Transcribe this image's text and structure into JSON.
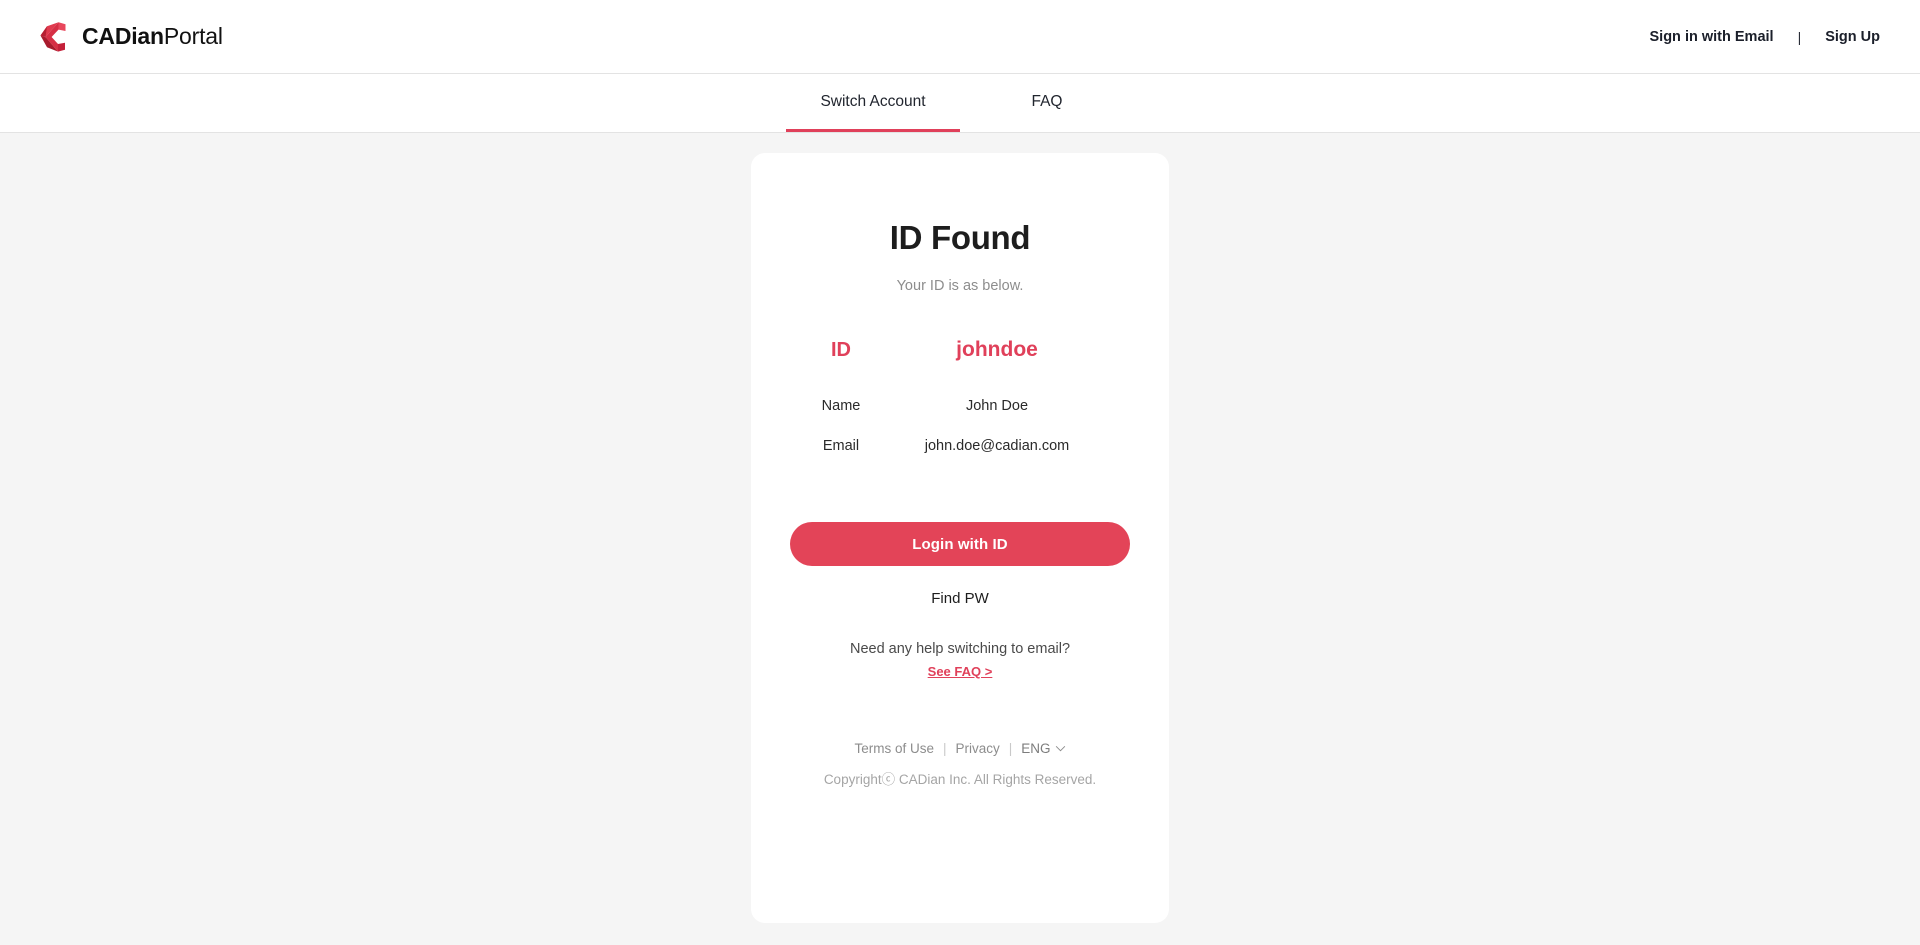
{
  "header": {
    "brand_bold": "CADian",
    "brand_light": "Portal",
    "logo_icon": "cadian-c-logo",
    "sign_in_label": "Sign in with Email",
    "separator": "|",
    "sign_up_label": "Sign Up"
  },
  "tabs": [
    {
      "label": "Switch Account",
      "active": true
    },
    {
      "label": "FAQ",
      "active": false
    }
  ],
  "card": {
    "title": "ID Found",
    "subtitle": "Your ID is as below.",
    "rows": [
      {
        "label": "ID",
        "value": "johndoe",
        "highlight": true
      },
      {
        "label": "Name",
        "value": "John Doe",
        "highlight": false
      },
      {
        "label": "Email",
        "value": "john.doe@cadian.com",
        "highlight": false
      }
    ],
    "login_button_label": "Login with ID",
    "find_pw_label": "Find PW",
    "help_text": "Need any help switching to email?",
    "faq_link_label": "See FAQ >"
  },
  "footer": {
    "terms_label": "Terms of Use",
    "divider": "|",
    "privacy_label": "Privacy",
    "language": "ENG",
    "chevron_icon": "chevron-down-icon",
    "copyright": "Copyrightⓒ CADian Inc. All Rights Reserved."
  },
  "colors": {
    "accent": "#e0405a",
    "button": "#e34458",
    "page_bg": "#f5f5f5",
    "card_bg": "#ffffff"
  }
}
